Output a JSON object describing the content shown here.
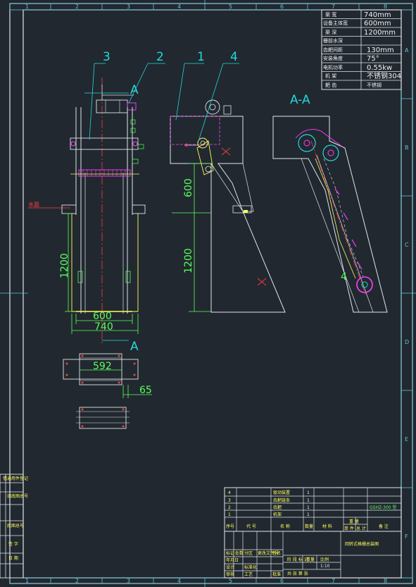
{
  "grid": {
    "columns": [
      "1",
      "2",
      "3",
      "4",
      "5",
      "6",
      "7",
      "8"
    ],
    "rows": [
      "A",
      "B",
      "C",
      "D",
      "E",
      "F"
    ]
  },
  "spec_table": [
    {
      "label": "渠 宽",
      "value": "740mm"
    },
    {
      "label": "设备主体宽",
      "value": "600mm"
    },
    {
      "label": "渠 深",
      "value": "1200mm"
    },
    {
      "label": "栅前水深",
      "value": ""
    },
    {
      "label": "齿耙间距",
      "value": "130mm"
    },
    {
      "label": "安装角度",
      "value": "75°"
    },
    {
      "label": "电机功率",
      "value": "0.55kw"
    },
    {
      "label": "机 架",
      "value": "不锈钢304"
    },
    {
      "label": "耙 齿",
      "value": "不锈钢"
    }
  ],
  "callouts": [
    "3",
    "2",
    "1",
    "4"
  ],
  "section_marks": {
    "top": "A",
    "bottom": "A",
    "view_title": "A-A"
  },
  "water_level_label": "水面",
  "dimensions": {
    "front_width": "600",
    "front_channel": "740",
    "front_depth": "1200",
    "side_upper": "600",
    "side_depth": "1200",
    "plan_width": "592",
    "plan_offset": "65"
  },
  "left_strip": [
    "借通用件登记",
    "旧底图总号",
    "底图总号",
    "签 字",
    "日 期"
  ],
  "parts_list": [
    {
      "no": "4",
      "name": "驱动装置",
      "qty": "1"
    },
    {
      "no": "3",
      "name": "齿耙链条",
      "qty": "1"
    },
    {
      "no": "2",
      "name": "齿耙",
      "qty": "1"
    },
    {
      "no": "1",
      "name": "机架",
      "qty": "1"
    }
  ],
  "parts_header": [
    "序号",
    "代 号",
    "名 称",
    "数量",
    "材 料",
    "单 件",
    "总 计",
    "备 注"
  ],
  "weight_header": "重 量",
  "parts_note": "GSHZ-300 型",
  "title_block": {
    "drawing_title": "回转式格栅总装图",
    "stage_label": "阶 段 标 记",
    "weight_label": "重量",
    "scale_label": "比例",
    "scale_value": "1:10",
    "sheet_label": "共 张  第 张",
    "signature_rows": [
      "标记",
      "处数",
      "分区",
      "更改文件号",
      "签名",
      "年月日",
      "设计",
      "标准化",
      "审核",
      "工艺",
      "批准"
    ]
  },
  "colors": {
    "background": "#212830",
    "frame": "#dfe6ea",
    "border_accent": "#5ec3d6",
    "dimension": "#5bff5b",
    "callout": "#23d8d8",
    "centerline": "#ff3b3b",
    "part_yellow": "#ffff55",
    "part_magenta": "#ff40ff"
  }
}
